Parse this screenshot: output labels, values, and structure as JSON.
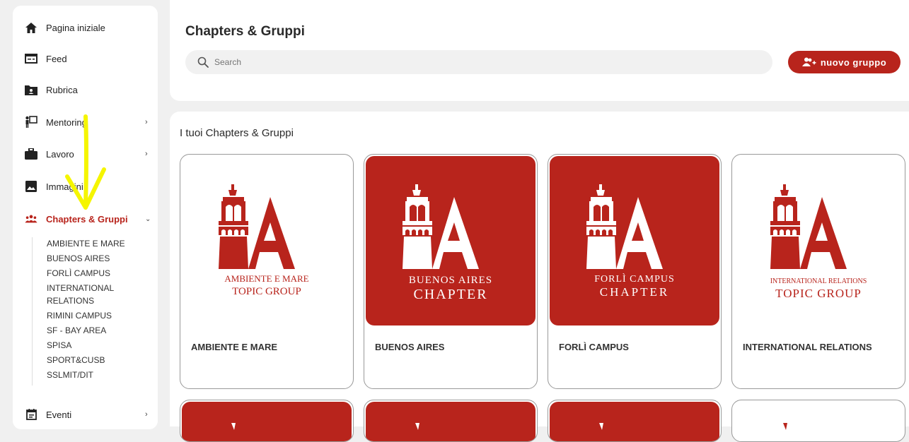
{
  "sidebar": {
    "items": [
      {
        "label": "Pagina iniziale",
        "icon": "home-icon"
      },
      {
        "label": "Feed",
        "icon": "feed-icon"
      },
      {
        "label": "Rubrica",
        "icon": "contacts-folder-icon"
      },
      {
        "label": "Mentoring",
        "icon": "mentoring-icon"
      },
      {
        "label": "Lavoro",
        "icon": "briefcase-icon"
      },
      {
        "label": "Immagini",
        "icon": "image-icon"
      },
      {
        "label": "Chapters & Gruppi",
        "icon": "group-icon"
      },
      {
        "label": "Eventi",
        "icon": "calendar-icon"
      }
    ],
    "subitems": [
      "AMBIENTE E MARE",
      "BUENOS AIRES",
      "FORLÌ CAMPUS",
      "INTERNATIONAL RELATIONS",
      "RIMINI CAMPUS",
      "SF - BAY AREA",
      "SPISA",
      "SPORT&CUSB",
      "SSLMIT/DIT"
    ]
  },
  "header": {
    "title": "Chapters & Gruppi",
    "search_placeholder": "Search",
    "new_button": "nuovo gruppo"
  },
  "main": {
    "section_title": "I tuoi Chapters & Gruppi",
    "cards": [
      {
        "name": "AMBIENTE E MARE",
        "logo_line1": "AMBIENTE E MARE",
        "logo_line2": "TOPIC GROUP",
        "style": "white"
      },
      {
        "name": "BUENOS AIRES",
        "logo_line1": "BUENOS AIRES",
        "logo_line2": "CHAPTER",
        "style": "red"
      },
      {
        "name": "FORLÌ CAMPUS",
        "logo_line1": "FORLÌ CAMPUS",
        "logo_line2": "CHAPTER",
        "style": "red"
      },
      {
        "name": "INTERNATIONAL RELATIONS",
        "logo_line1": "INTERNATIONAL RELATIONS",
        "logo_line2": "TOPIC GROUP",
        "style": "white"
      }
    ]
  },
  "colors": {
    "accent": "#b8241c",
    "annotation": "#f5f500"
  }
}
